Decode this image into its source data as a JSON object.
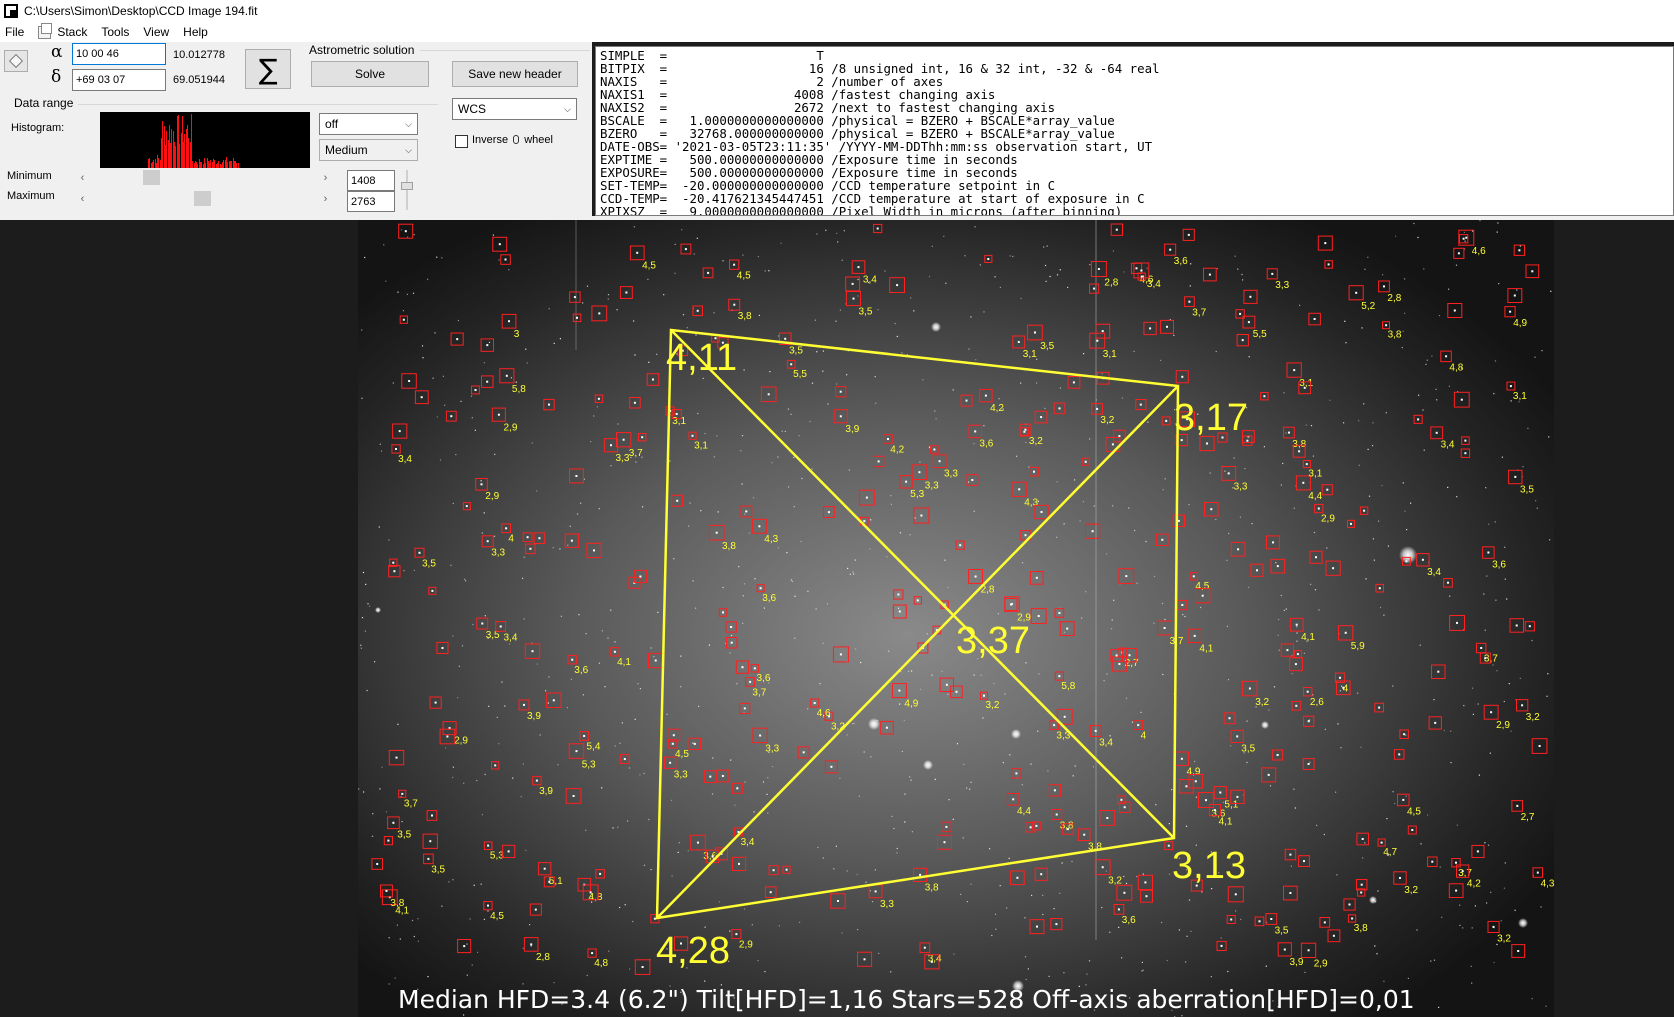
{
  "window": {
    "title": "C:\\Users\\Simon\\Desktop\\CCD Image 194.fit"
  },
  "menu": {
    "file": "File",
    "stack": "Stack",
    "tools": "Tools",
    "view": "View",
    "help": "Help"
  },
  "coords": {
    "alpha_symbol": "α",
    "delta_symbol": "δ",
    "alpha_input": "10 00 46",
    "delta_input": "+69 03 07",
    "alpha_value": "10.012778",
    "delta_value": "69.051944"
  },
  "astrometry": {
    "group_label": "Astrometric solution",
    "sigma_symbol": "∑",
    "solve_label": "Solve",
    "save_header_label": "Save new header"
  },
  "data_range": {
    "group_label": "Data range",
    "histogram_label": "Histogram:",
    "minimum_label": "Minimum",
    "maximum_label": "Maximum",
    "minimum_value": "1408",
    "maximum_value": "2763",
    "stretch_select": "off",
    "gamma_select": "Medium"
  },
  "wcs": {
    "select": "WCS",
    "inverse_label": "Inverse",
    "wheel_label": "wheel"
  },
  "fits_header": [
    "SIMPLE  =                    T",
    "BITPIX  =                   16 /8 unsigned int, 16 & 32 int, -32 & -64 real",
    "NAXIS   =                    2 /number of axes",
    "NAXIS1  =                 4008 /fastest changing axis",
    "NAXIS2  =                 2672 /next to fastest changing axis",
    "BSCALE  =   1.0000000000000000 /physical = BZERO + BSCALE*array_value",
    "BZERO   =   32768.000000000000 /physical = BZERO + BSCALE*array_value",
    "DATE-OBS= '2021-03-05T23:11:35' /YYYY-MM-DDThh:mm:ss observation start, UT",
    "EXPTIME =   500.00000000000000 /Exposure time in seconds",
    "EXPOSURE=   500.00000000000000 /Exposure time in seconds",
    "SET-TEMP=  -20.000000000000000 /CCD temperature setpoint in C",
    "CCD-TEMP=  -20.417621345447451 /CCD temperature at start of exposure in C",
    "XPIXSZ  =   9.0000000000000000 /Pixel Width in microns (after binning)"
  ],
  "tilt_overlay": {
    "corner_top_left": "4,11",
    "corner_top_right": "3,17",
    "corner_bottom_left": "4,28",
    "corner_bottom_right": "3,13",
    "center": "3,37",
    "line_color": "#ffff33",
    "box_color": "#ff2020"
  },
  "status_line": "Median HFD=3.4 (6.2\")  Tilt[HFD]=1,16  Stars=528  Off-axis aberration[HFD]=0,01",
  "star_labels": [
    "5,9",
    "4",
    "4,5",
    "3,8",
    "4",
    "3,5",
    "3,2",
    "3,5",
    "3,8",
    "5,3",
    "4,6",
    "4,7",
    "3,9",
    "3,7",
    "3,4",
    "3,6",
    "5,8",
    "5,4",
    "4,8",
    "4,1",
    "3,4",
    "3,2",
    "4,3",
    "4,1",
    "5,1",
    "3,6",
    "3,3",
    "3,1",
    "3,5",
    "3,9",
    "4,8",
    "3,7",
    "4,4",
    "5,2",
    "2,8",
    "3,3",
    "4,1",
    "3,1",
    "3,8",
    "3,5",
    "4,9",
    "3,6",
    "2,9",
    "3,2",
    "5,3",
    "4,9",
    "3,2",
    "3,7",
    "4,2",
    "3,3",
    "2,9",
    "5,5",
    "5,1",
    "4,5",
    "3,6",
    "3,8",
    "3,3",
    "2,8",
    "3,1",
    "3,4",
    "2,7",
    "4,8",
    "4,5",
    "3,9",
    "4",
    "3,1",
    "3,7",
    "3,5",
    "2,9",
    "3,2",
    "3,5",
    "4,6",
    "4,5",
    "3,8",
    "4,5",
    "3,3",
    "3,4",
    "3,6",
    "2,9",
    "3",
    "2,8",
    "5,5",
    "4,9",
    "3,7",
    "3,4",
    "3,6",
    "2,6",
    "3,4",
    "4,3",
    "3,3",
    "4,1",
    "3,8",
    "3,2",
    "3,5",
    "3,7",
    "3,4",
    "4,2",
    "3,3",
    "5,3",
    "4,6",
    "3,5",
    "3,8",
    "3,6",
    "2,9",
    "2,7",
    "3,1",
    "3,4",
    "4,5",
    "3,9",
    "3,2",
    "4,2",
    "3,7",
    "3,3",
    "2,8",
    "3,2",
    "2,9",
    "3,8",
    "3,6",
    "5,8",
    "4,4",
    "3,5",
    "3,6",
    "3,4",
    "3,1",
    "3,3",
    "2,9",
    "4,3",
    "3,8",
    "4,1",
    "3,1",
    "3,2",
    "3,5",
    "2,9",
    "3,3"
  ],
  "status_note": ""
}
